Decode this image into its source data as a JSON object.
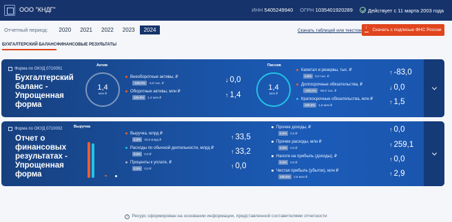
{
  "header": {
    "company": "ООО \"КНДГ\"",
    "inn_label": "ИНН",
    "inn": "5405249940",
    "ogrn_label": "ОГРН",
    "ogrn": "1035401920289",
    "status": "Действует с 11 марта 2003 года"
  },
  "period": {
    "label": "Отчетный период:",
    "years": [
      "2020",
      "2021",
      "2022",
      "2023",
      "2024"
    ],
    "selected": "2024"
  },
  "actions": {
    "download_link": "Скачать таблицей или текстом",
    "sign_button": "Скачать с подписью ФНС России"
  },
  "tabs": [
    "БУХГАЛТЕРСКИЙ БАЛАНС",
    "ФИНАНСОВЫЕ РЕЗУЛЬТАТЫ"
  ],
  "balance": {
    "form_code": "Форма по ОКУД 0710001",
    "title": "Бухгалтерский баланс - Упрощенная форма",
    "assets": {
      "label": "Актив",
      "total": "1,4",
      "unit": "млн ₽",
      "rows": [
        {
          "label": "Внеоборотные активы, ₽",
          "pct": "-100,0%",
          "prev": "-4,0 тыс. ₽",
          "arrow": "↓",
          "value": "0,0"
        },
        {
          "label": "Оборотные активы, млн ₽",
          "pct": "100,0%",
          "prev": "1,4 млн ₽",
          "arrow": "↑",
          "value": "1,4"
        }
      ]
    },
    "liabilities": {
      "label": "Пассив",
      "total": "1,4",
      "unit": "млн ₽",
      "rows": [
        {
          "label": "Капитал и резервы, тыс. ₽",
          "pct": "3,5%",
          "prev": "5,0 тыс. ₽",
          "arrow": "↑",
          "value": "-83,0"
        },
        {
          "label": "Долгосрочные обязательства, ₽",
          "pct": "-100,0%",
          "prev": "-90,0 тыс. ₽",
          "arrow": "↓",
          "value": "0,0"
        },
        {
          "label": "Краткосрочные обязательства, млн ₽",
          "pct": "100,0%",
          "prev": "1,5 млн ₽",
          "arrow": "↑",
          "value": "1,5"
        }
      ]
    }
  },
  "results": {
    "form_code": "Форма по ОКУД 0710002",
    "title": "Отчет о финансовых результатах - Упрощенная форма",
    "revenue_label": "Выручка",
    "left_rows": [
      {
        "label": "Выручка, млрд ₽",
        "pct": "0,0%",
        "prev": "33,5 млрд ₽",
        "arrow": "↑",
        "value": "33,5"
      },
      {
        "label": "Расходы по обычной деятельности, млрд ₽",
        "pct": "0,0%",
        "prev": "0,0 ₽",
        "arrow": "↑",
        "value": "33,2"
      },
      {
        "label": "Проценты к уплате, ₽",
        "pct": "0,0%",
        "prev": "0,0 ₽",
        "arrow": "↑",
        "value": "0,0"
      }
    ],
    "right_rows": [
      {
        "label": "Прочие доходы, ₽",
        "pct": "0,0%",
        "prev": "0,0 ₽",
        "arrow": "↑",
        "value": "0,0"
      },
      {
        "label": "Прочие расходы, млн ₽",
        "pct": "0,0%",
        "prev": "0,0 ₽",
        "arrow": "↑",
        "value": "259,1"
      },
      {
        "label": "Налоги на прибыль (доходы), ₽",
        "pct": "0,0%",
        "prev": "0,0 ₽",
        "arrow": "↑",
        "value": "0,0"
      },
      {
        "label": "Чистая прибыль (убыток), млн ₽",
        "pct": "100,0%",
        "prev": "2,9 млн ₽",
        "arrow": "↑",
        "value": "2,9"
      }
    ]
  },
  "footer": "Ресурс сформирован на основании информации, представленной составителями отчетности",
  "colors": {
    "header_bg": "#16336b",
    "accent_orange": "#e0451d",
    "card_blue": "#1a53a5",
    "dot_orange": "#e8612d",
    "dot_cyan": "#22c3e6",
    "dot_gray": "#aab7cc"
  }
}
